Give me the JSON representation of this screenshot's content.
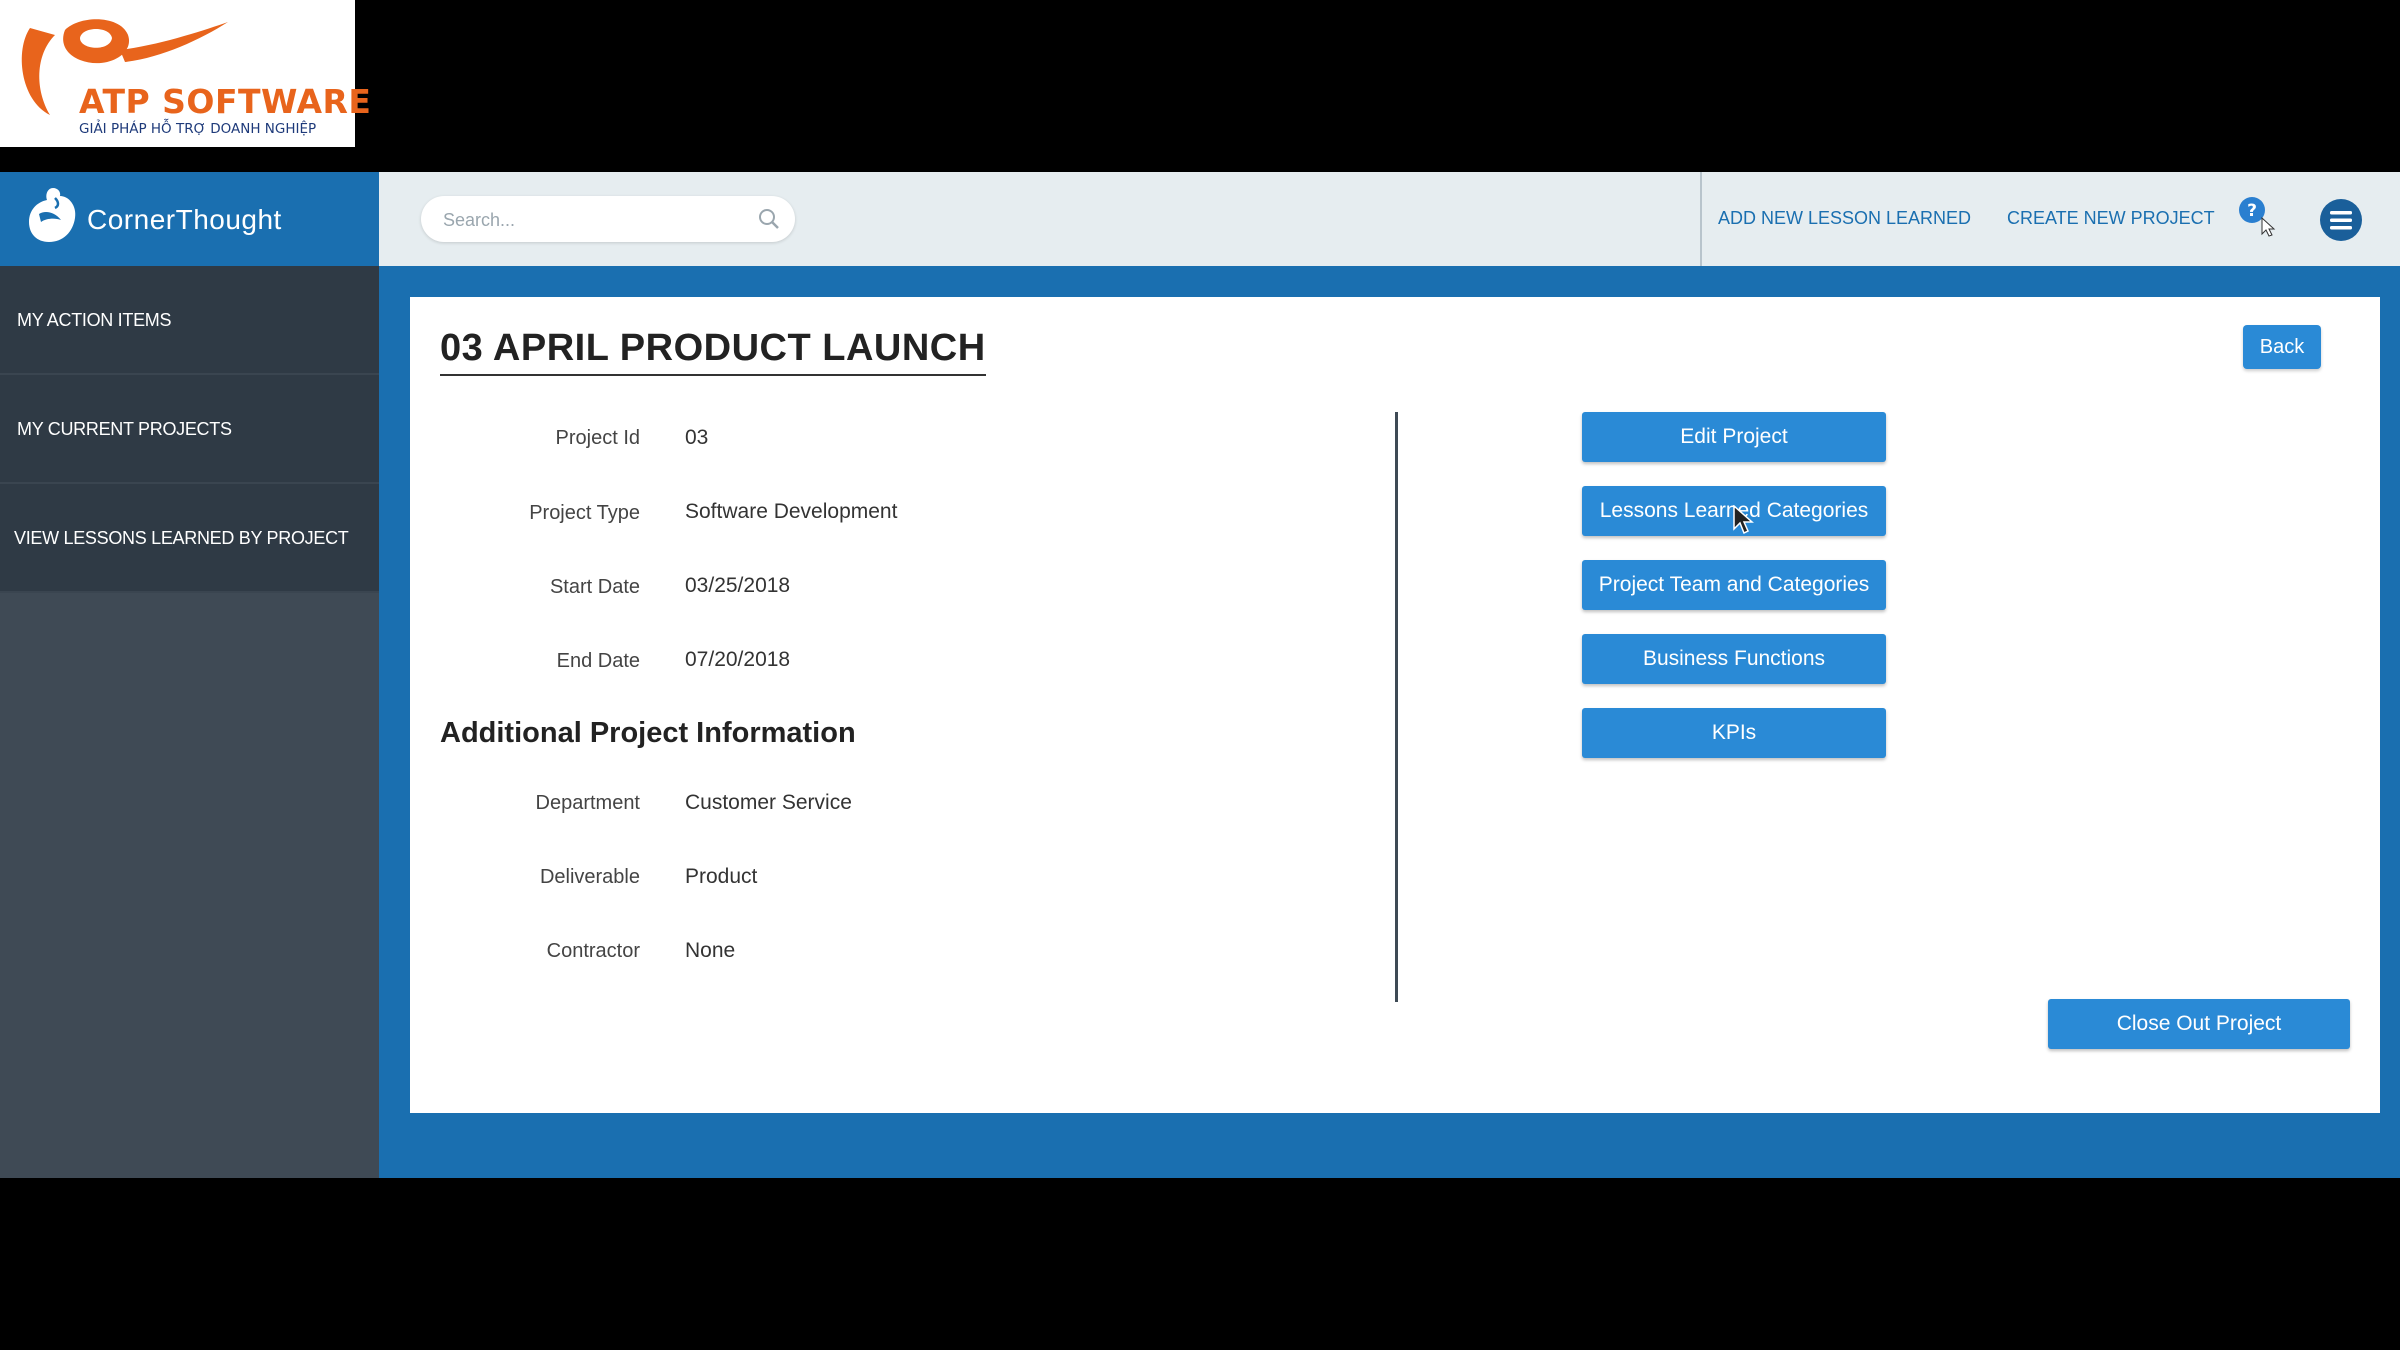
{
  "watermark": {
    "brand": "ATP SOFTWARE",
    "tagline": "GIẢI PHÁP HỖ TRỢ DOANH NGHIỆP",
    "brand_color": "#e8641c",
    "tagline_color": "#1e3a7a"
  },
  "app": {
    "name": "CornerThought",
    "brand_color": "#1a6fb0",
    "accent_button_color": "#2a8ad6"
  },
  "topbar": {
    "search_placeholder": "Search...",
    "add_lesson_label": "ADD NEW LESSON LEARNED",
    "create_project_label": "CREATE NEW PROJECT",
    "help_icon": "help-icon",
    "menu_icon": "hamburger-menu-icon"
  },
  "sidebar": {
    "items": [
      {
        "label": "MY ACTION ITEMS"
      },
      {
        "label": "MY CURRENT PROJECTS"
      },
      {
        "label": "VIEW LESSONS LEARNED BY PROJECT"
      }
    ]
  },
  "project": {
    "title": "03 APRIL PRODUCT LAUNCH",
    "back_label": "Back",
    "fields": [
      {
        "label": "Project Id",
        "value": "03"
      },
      {
        "label": "Project Type",
        "value": "Software Development"
      },
      {
        "label": "Start Date",
        "value": "03/25/2018"
      },
      {
        "label": "End Date",
        "value": "07/20/2018"
      }
    ],
    "additional_title": "Additional Project Information",
    "additional_fields": [
      {
        "label": "Department",
        "value": "Customer Service"
      },
      {
        "label": "Deliverable",
        "value": "Product"
      },
      {
        "label": "Contractor",
        "value": "None"
      }
    ],
    "actions": [
      {
        "label": "Edit Project"
      },
      {
        "label": "Lessons Learned Categories"
      },
      {
        "label": "Project Team and Categories"
      },
      {
        "label": "Business Functions"
      },
      {
        "label": "KPIs"
      }
    ],
    "close_label": "Close Out Project"
  }
}
